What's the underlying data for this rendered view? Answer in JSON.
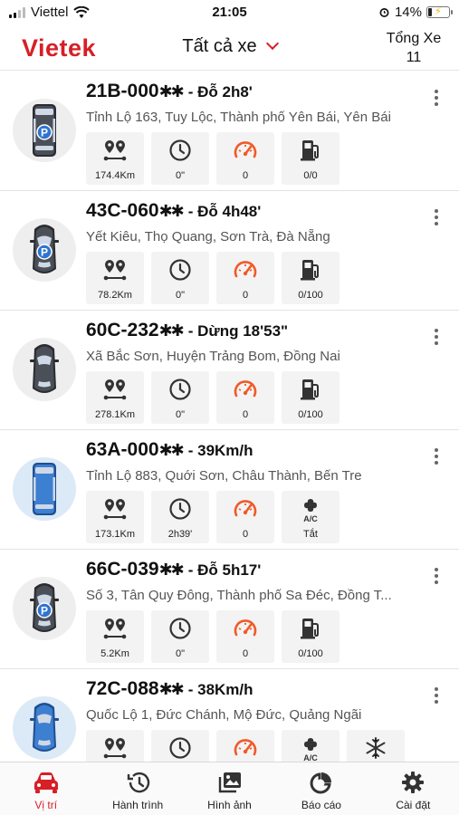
{
  "status_bar": {
    "carrier": "Viettel",
    "time": "21:05",
    "battery": "14%"
  },
  "header": {
    "logo": "Vietek",
    "filter_label": "Tất cả xe",
    "total_label": "Tổng Xe",
    "total_count": "11"
  },
  "vehicles": [
    {
      "plate": "21B-000",
      "mask": "✱✱",
      "status": "- Đỗ 2h8'",
      "address": "Tỉnh Lộ 163, Tuy Lộc, Thành phố Yên Bái, Yên Bái",
      "icon": "parked-van-icon",
      "metrics": [
        {
          "icon": "route-icon",
          "value": "174.4Km"
        },
        {
          "icon": "clock-icon",
          "value": "0\""
        },
        {
          "icon": "speedometer-icon",
          "value": "0"
        },
        {
          "icon": "fuel-icon",
          "value": "0/0"
        }
      ]
    },
    {
      "plate": "43C-060",
      "mask": "✱✱",
      "status": "- Đỗ 4h48'",
      "address": "Yết Kiêu, Thọ Quang, Sơn Trà, Đà Nẵng",
      "icon": "parked-car-icon",
      "metrics": [
        {
          "icon": "route-icon",
          "value": "78.2Km"
        },
        {
          "icon": "clock-icon",
          "value": "0\""
        },
        {
          "icon": "speedometer-icon",
          "value": "0"
        },
        {
          "icon": "fuel-icon",
          "value": "0/100"
        }
      ]
    },
    {
      "plate": "60C-232",
      "mask": "✱✱",
      "status": "- Dừng 18'53\"",
      "address": "Xã Bắc Sơn, Huyện Trảng Bom, Đồng Nai",
      "icon": "stopped-car-icon",
      "metrics": [
        {
          "icon": "route-icon",
          "value": "278.1Km"
        },
        {
          "icon": "clock-icon",
          "value": "0\""
        },
        {
          "icon": "speedometer-icon",
          "value": "0"
        },
        {
          "icon": "fuel-icon",
          "value": "0/100"
        }
      ]
    },
    {
      "plate": "63A-000",
      "mask": "✱✱",
      "status": "- 39Km/h",
      "address": "Tỉnh Lộ 883, Quới Sơn, Châu Thành, Bến Tre",
      "icon": "moving-bus-icon",
      "metrics": [
        {
          "icon": "route-icon",
          "value": "173.1Km"
        },
        {
          "icon": "clock-icon",
          "value": "2h39'"
        },
        {
          "icon": "speedometer-icon",
          "value": "0"
        },
        {
          "icon": "ac-icon",
          "value": "Tắt"
        }
      ]
    },
    {
      "plate": "66C-039",
      "mask": "✱✱",
      "status": "- Đỗ 5h17'",
      "address": "Số 3, Tân Quy Đông, Thành phố Sa Đéc, Đồng T...",
      "icon": "parked-car-icon",
      "metrics": [
        {
          "icon": "route-icon",
          "value": "5.2Km"
        },
        {
          "icon": "clock-icon",
          "value": "0\""
        },
        {
          "icon": "speedometer-icon",
          "value": "0"
        },
        {
          "icon": "fuel-icon",
          "value": "0/100"
        }
      ]
    },
    {
      "plate": "72C-088",
      "mask": "✱✱",
      "status": "- 38Km/h",
      "address": "Quốc Lộ 1, Đức Chánh, Mộ Đức, Quảng Ngãi",
      "icon": "moving-car-icon",
      "metrics": [
        {
          "icon": "route-icon",
          "value": ""
        },
        {
          "icon": "clock-icon",
          "value": ""
        },
        {
          "icon": "speedometer-icon",
          "value": ""
        },
        {
          "icon": "ac-icon",
          "value": ""
        },
        {
          "icon": "snowflake-icon",
          "value": ""
        }
      ]
    }
  ],
  "nav": [
    {
      "label": "Vị trí",
      "icon": "car-icon",
      "active": true
    },
    {
      "label": "Hành trình",
      "icon": "history-icon",
      "active": false
    },
    {
      "label": "Hình ảnh",
      "icon": "images-icon",
      "active": false
    },
    {
      "label": "Báo cáo",
      "icon": "report-icon",
      "active": false
    },
    {
      "label": "Cài đặt",
      "icon": "settings-icon",
      "active": false
    }
  ],
  "colors": {
    "brand": "#d71f26",
    "accent": "#f05a28",
    "icon": "#333333"
  }
}
